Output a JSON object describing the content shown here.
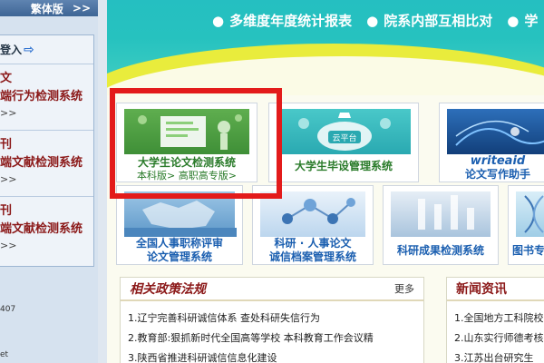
{
  "sidebar": {
    "traditional_label": "繁体版",
    "traditional_chevron": ">>",
    "login_label": "登入",
    "items": [
      {
        "line1": "文",
        "line2": "端行为检测系统",
        "more": ">>"
      },
      {
        "line1": "刊",
        "line2": "端文献检测系统",
        "more": ">>"
      },
      {
        "line1": "刊",
        "line2": "端文献检测系统",
        "more": ">>"
      }
    ],
    "misc1": "407",
    "misc2": "et"
  },
  "banner": {
    "items": [
      "多维度年度统计报表",
      "院系内部互相比对",
      "学"
    ]
  },
  "tiles": {
    "thesis": {
      "title": "大学生论文检测系统",
      "sub_undergrad": "本科版>",
      "sub_vocational": "高职高专版>"
    },
    "graduation": {
      "title": "大学生毕设管理系统",
      "badge": "云平台"
    },
    "writing": {
      "title": "论文写作助手",
      "logo": "writeaid"
    },
    "title_review": {
      "line1": "全国人事职称评审",
      "line2": "论文管理系统"
    },
    "research_hr": {
      "line1": "科研 · 人事论文",
      "line2": "诚信档案管理系统"
    },
    "research_results": {
      "title": "科研成果检测系统"
    },
    "books": {
      "title": "图书专"
    }
  },
  "policy": {
    "title": "相关政策法规",
    "more": "更多",
    "items": [
      "1.辽宁完善科研诚信体系 查处科研失信行为",
      "2.教育部:狠抓新时代全国高等学校 本科教育工作会议精",
      "3.陕西省推进科研诚信信息化建设"
    ]
  },
  "news": {
    "title": "新闻资讯",
    "items": [
      "1.全国地方工科院校",
      "2.山东实行师德考核",
      "3.江苏出台研究生"
    ]
  }
}
